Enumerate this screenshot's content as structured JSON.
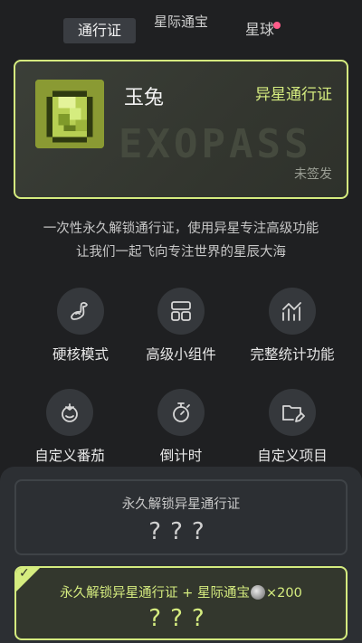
{
  "tabs": [
    {
      "label": "通行证"
    },
    {
      "label": "星际通宝"
    },
    {
      "label": "星球"
    }
  ],
  "pass_card": {
    "name": "玉兔",
    "type": "异星通行证",
    "watermark": "EXOPASS",
    "status": "未签发"
  },
  "description": {
    "line1": "一次性永久解锁通行证，使用异星专注高级功能",
    "line2": "让我们一起飞向专注世界的星辰大海"
  },
  "features": [
    {
      "label": "硬核模式",
      "icon": "muscle-icon"
    },
    {
      "label": "高级小组件",
      "icon": "widget-icon"
    },
    {
      "label": "完整统计功能",
      "icon": "stats-icon"
    },
    {
      "label": "自定义番茄",
      "icon": "tomato-icon"
    },
    {
      "label": "倒计时",
      "icon": "stopwatch-icon"
    },
    {
      "label": "自定义项目",
      "icon": "folder-edit-icon"
    }
  ],
  "purchase_options": [
    {
      "title": "永久解锁异星通行证",
      "price": "???",
      "selected": false
    },
    {
      "title_prefix": "永久解锁异星通行证 + 星际通宝",
      "title_suffix": "×200",
      "price": "???",
      "selected": true
    }
  ],
  "colors": {
    "accent": "#d5ec7f",
    "background": "#1f2022",
    "badge": "#ff5c8a"
  }
}
